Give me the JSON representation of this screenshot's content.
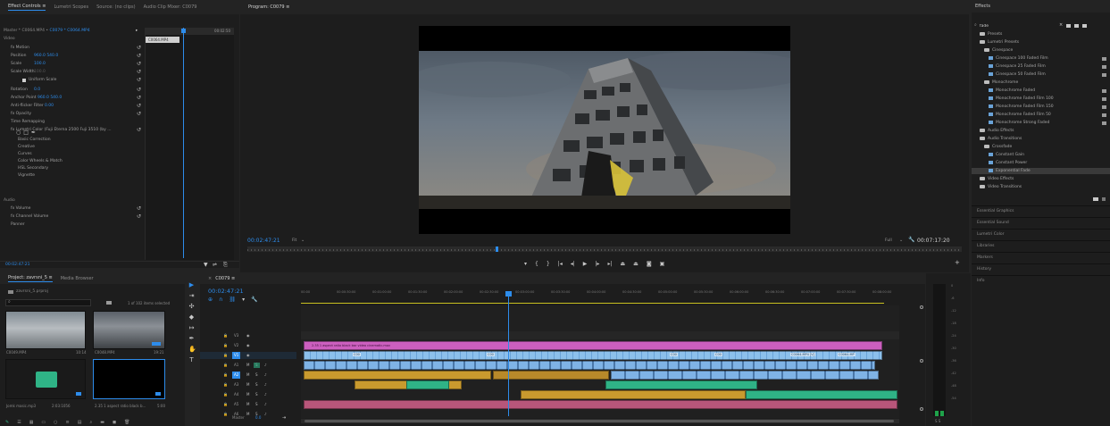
{
  "effect_controls": {
    "tabs": [
      "Effect Controls ≡",
      "Lumetri Scopes",
      "Source: (no clips)",
      "Audio Clip Mixer: C0079"
    ],
    "master_label": "Master * C0064.MP4",
    "sequence_label": "C0079 * C0064.MP4",
    "clip_time": "00:02:50",
    "clip_chip": "C0064.MP4",
    "section_video": "Video",
    "rows": [
      {
        "label": "fx Motion",
        "val": "",
        "reset": "↺"
      },
      {
        "label": "Position",
        "val": "960.0    540.0",
        "reset": "↺"
      },
      {
        "label": "Scale",
        "val": "100.0",
        "reset": "↺"
      },
      {
        "label": "Scale Width",
        "val": "100.0",
        "reset": "↺"
      },
      {
        "label": "Uniform Scale",
        "val": "",
        "reset": "↺"
      },
      {
        "label": "Rotation",
        "val": "0.0",
        "reset": "↺"
      },
      {
        "label": "Anchor Point",
        "val": "960.0    540.0",
        "reset": "↺"
      },
      {
        "label": "Anti-flicker Filter",
        "val": "0.00",
        "reset": "↺"
      },
      {
        "label": "fx Opacity",
        "val": "",
        "reset": "↺"
      },
      {
        "label": "Time Remapping",
        "val": "",
        "reset": ""
      },
      {
        "label": "fx Lumetri Color (Fuji Eterna 2500 Fuji 3510 (by ...",
        "val": "",
        "reset": "↺"
      },
      {
        "label": "Basic Correction",
        "val": "",
        "reset": ""
      },
      {
        "label": "Creative",
        "val": "",
        "reset": ""
      },
      {
        "label": "Curves",
        "val": "",
        "reset": ""
      },
      {
        "label": "Color Wheels & Match",
        "val": "",
        "reset": ""
      },
      {
        "label": "HSL Secondary",
        "val": "",
        "reset": ""
      },
      {
        "label": "Vignette",
        "val": "",
        "reset": ""
      }
    ],
    "section_audio": "Audio",
    "audio_rows": [
      {
        "label": "fx Volume",
        "reset": "↺"
      },
      {
        "label": "fx Channel Volume",
        "reset": "↺"
      },
      {
        "label": "Panner",
        "reset": ""
      }
    ],
    "bottom_time": "00:02:47:21"
  },
  "program": {
    "title": "Program: C0079 ≡",
    "timecode": "00:02:47:21",
    "fit": "Fit",
    "resolution": "Full",
    "duration": "00:07:17:20"
  },
  "project": {
    "tabs": [
      "Project: zavrsni_5 ≡",
      "Media Browser"
    ],
    "file": "zavrsni_5.prproj",
    "selection": "1 of 102 items selected",
    "items": [
      {
        "name": "C0049.MP4",
        "dur": "10:14"
      },
      {
        "name": "C0048.MP4",
        "dur": "19:21"
      },
      {
        "name": "Jomk masic.mp3",
        "dur": "2:03:1056"
      },
      {
        "name": "2.35 1 aspect ratio black b...",
        "dur": "5:00"
      }
    ]
  },
  "timeline": {
    "title": "C0079 ≡",
    "timecode": "00:02:47:21",
    "ruler": [
      "00:00",
      "00:00:30:00",
      "00:01:00:00",
      "00:01:30:00",
      "00:02:00:00",
      "00:02:30:00",
      "00:03:00:00",
      "00:03:30:00",
      "00:04:00:00",
      "00:04:30:00",
      "00:05:00:00",
      "00:05:30:00",
      "00:06:00:00",
      "00:06:30:00",
      "00:07:00:00",
      "00:07:30:00",
      "00:08:00:00"
    ],
    "tracks_video": [
      "V3",
      "V2",
      "V1"
    ],
    "tracks_audio": [
      "A1",
      "A2",
      "A3",
      "A4",
      "A5",
      "A6"
    ],
    "master": "Master",
    "master_val": "0.0",
    "pink_clip": "2.35 1 aspect ratio black bar video cinematic.mov",
    "v1_labels": [
      "C00",
      "C00",
      "C00",
      "C00",
      "C0064.MP4 [V]",
      "C0064.MP"
    ],
    "meter_labels": [
      "0",
      "-6",
      "-12",
      "-18",
      "-24",
      "-30",
      "-36",
      "-42",
      "-48",
      "-54"
    ],
    "meter_bottom": "S    S"
  },
  "effects": {
    "title": "Effects",
    "search": "fade",
    "tree": [
      {
        "label": "Presets",
        "indent": 1,
        "type": "folder"
      },
      {
        "label": "Lumetri Presets",
        "indent": 1,
        "type": "folder"
      },
      {
        "label": "Cinespace",
        "indent": 2,
        "type": "folder"
      },
      {
        "label": "Cinespace 100 Faded Film",
        "indent": 3,
        "type": "fx"
      },
      {
        "label": "Cinespace 25 Faded Film",
        "indent": 3,
        "type": "fx"
      },
      {
        "label": "Cinespace 50 Faded Film",
        "indent": 3,
        "type": "fx"
      },
      {
        "label": "Monochrome",
        "indent": 2,
        "type": "folder"
      },
      {
        "label": "Monochrome Faded",
        "indent": 3,
        "type": "fx"
      },
      {
        "label": "Monochrome Faded Film 100",
        "indent": 3,
        "type": "fx"
      },
      {
        "label": "Monochrome Faded Film 150",
        "indent": 3,
        "type": "fx"
      },
      {
        "label": "Monochrome Faded Film 50",
        "indent": 3,
        "type": "fx"
      },
      {
        "label": "Monochrome Strong Faded",
        "indent": 3,
        "type": "fx"
      },
      {
        "label": "Audio Effects",
        "indent": 1,
        "type": "folder"
      },
      {
        "label": "Audio Transitions",
        "indent": 1,
        "type": "folder"
      },
      {
        "label": "Crossfade",
        "indent": 2,
        "type": "folder"
      },
      {
        "label": "Constant Gain",
        "indent": 3,
        "type": "fx"
      },
      {
        "label": "Constant Power",
        "indent": 3,
        "type": "fx"
      },
      {
        "label": "Exponential Fade",
        "indent": 3,
        "type": "fx-selected"
      },
      {
        "label": "Video Effects",
        "indent": 1,
        "type": "folder"
      },
      {
        "label": "Video Transitions",
        "indent": 1,
        "type": "folder"
      }
    ],
    "sections": [
      "Essential Graphics",
      "Essential Sound",
      "Lumetri Color",
      "Libraries",
      "Markers",
      "History",
      "Info"
    ]
  },
  "colors": {
    "accent": "#2d8ceb",
    "pink": "#cc5fbf",
    "video": "#7fb3e6",
    "audio_yellow": "#c99a2e",
    "audio_green": "#2fb386"
  }
}
